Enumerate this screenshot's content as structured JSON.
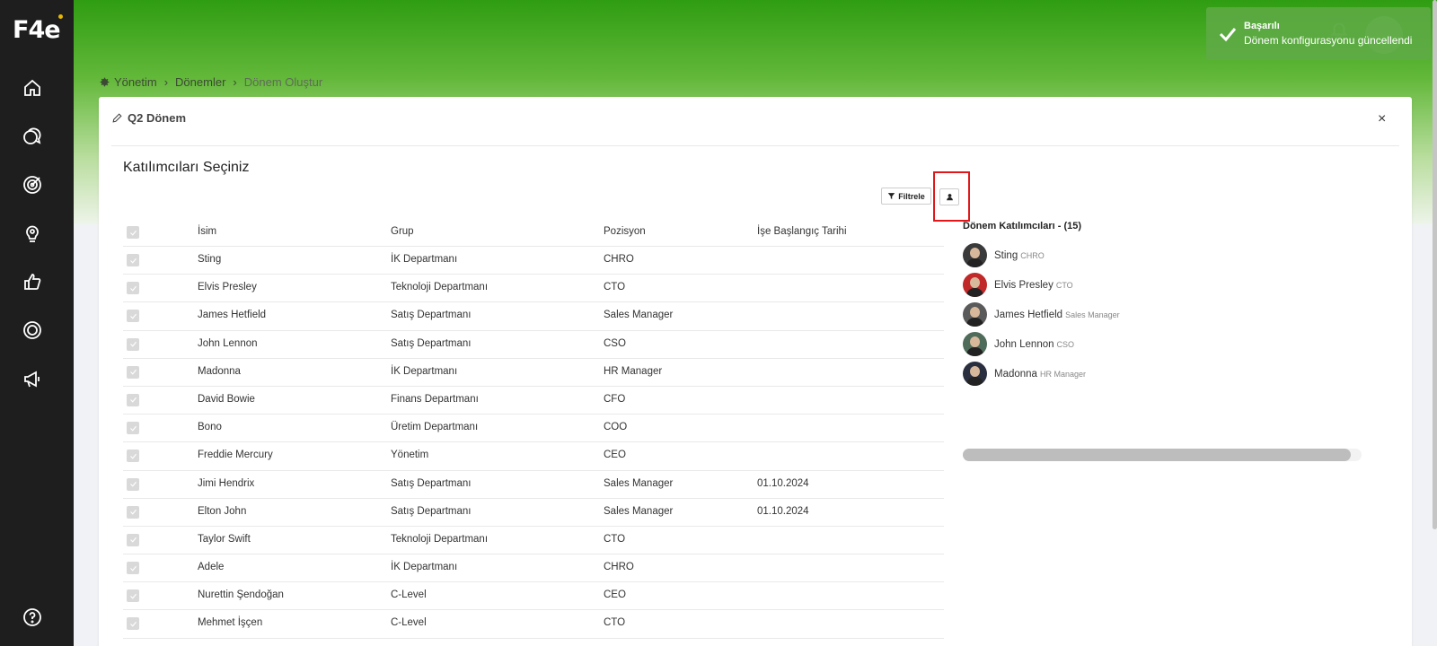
{
  "app": {
    "logo": "F4e"
  },
  "toast": {
    "title": "Başarılı",
    "message": "Dönem konfigurasyonu güncellendi"
  },
  "breadcrumb": {
    "items": [
      "Yönetim",
      "Dönemler",
      "Dönem Oluştur"
    ]
  },
  "card": {
    "title": "Q2 Dönem",
    "close_label": "×",
    "section_title": "Katılımcıları Seçiniz",
    "filter_label": "Filtrele"
  },
  "table": {
    "headers": [
      "İsim",
      "Grup",
      "Pozisyon",
      "İşe Başlangıç Tarihi"
    ],
    "rows": [
      [
        "Sting",
        "İK Departmanı",
        "CHRO",
        ""
      ],
      [
        "Elvis Presley",
        "Teknoloji Departmanı",
        "CTO",
        ""
      ],
      [
        "James Hetfield",
        "Satış Departmanı",
        "Sales Manager",
        ""
      ],
      [
        "John Lennon",
        "Satış Departmanı",
        "CSO",
        ""
      ],
      [
        "Madonna",
        "İK Departmanı",
        "HR Manager",
        ""
      ],
      [
        "David Bowie",
        "Finans Departmanı",
        "CFO",
        ""
      ],
      [
        "Bono",
        "Üretim Departmanı",
        "COO",
        ""
      ],
      [
        "Freddie Mercury",
        "Yönetim",
        "CEO",
        ""
      ],
      [
        "Jimi Hendrix",
        "Satış Departmanı",
        "Sales Manager",
        "01.10.2024"
      ],
      [
        "Elton John",
        "Satış Departmanı",
        "Sales Manager",
        "01.10.2024"
      ],
      [
        "Taylor Swift",
        "Teknoloji Departmanı",
        "CTO",
        ""
      ],
      [
        "Adele",
        "İK Departmanı",
        "CHRO",
        ""
      ],
      [
        "Nurettin Şendoğan",
        "C-Level",
        "CEO",
        ""
      ],
      [
        "Mehmet İşçen",
        "C-Level",
        "CTO",
        ""
      ]
    ]
  },
  "participants": {
    "title": "Dönem Katılımcıları - (15)",
    "items": [
      {
        "name": "Sting",
        "role": "CHRO",
        "color": "#3a3a3a"
      },
      {
        "name": "Elvis Presley",
        "role": "CTO",
        "color": "#c0282a"
      },
      {
        "name": "James Hetfield",
        "role": "Sales Manager",
        "color": "#5a5a5a"
      },
      {
        "name": "John Lennon",
        "role": "CSO",
        "color": "#4f6b5a"
      },
      {
        "name": "Madonna",
        "role": "HR Manager",
        "color": "#2a2f3f"
      }
    ]
  },
  "colors": {
    "accent": "#2f9d12",
    "sidebar": "#1e1e1e",
    "highlight": "#e0181b"
  }
}
